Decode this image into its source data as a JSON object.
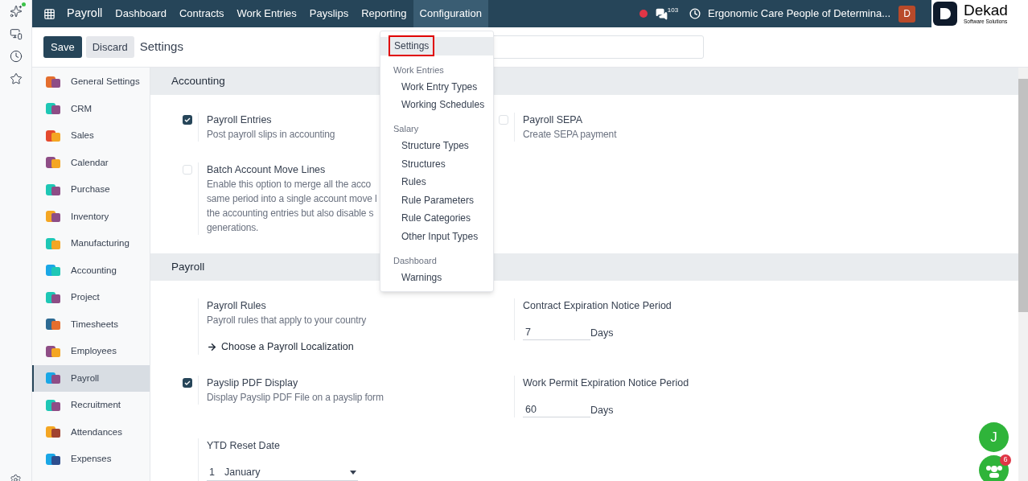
{
  "navbar": {
    "app_name": "Payroll",
    "menus": [
      {
        "label": "Dashboard",
        "selected": false
      },
      {
        "label": "Contracts",
        "selected": false
      },
      {
        "label": "Work Entries",
        "selected": false
      },
      {
        "label": "Payslips",
        "selected": false
      },
      {
        "label": "Reporting",
        "selected": false
      },
      {
        "label": "Configuration",
        "selected": true
      }
    ],
    "messages_count": "103",
    "company": "Ergonomic Care People of Determina...",
    "avatar": "D"
  },
  "logo": {
    "name": "Dekad",
    "tagline": "Software Solutions"
  },
  "control_panel": {
    "save": "Save",
    "discard": "Discard",
    "title": "Settings"
  },
  "dropdown": [
    {
      "kind": "item",
      "label": "Settings",
      "selected": true
    },
    {
      "kind": "header",
      "label": "Work Entries"
    },
    {
      "kind": "item",
      "label": "Work Entry Types",
      "selected": false
    },
    {
      "kind": "item",
      "label": "Working Schedules",
      "selected": false
    },
    {
      "kind": "header",
      "label": "Salary"
    },
    {
      "kind": "item",
      "label": "Structure Types",
      "selected": false
    },
    {
      "kind": "item",
      "label": "Structures",
      "selected": false
    },
    {
      "kind": "item",
      "label": "Rules",
      "selected": false
    },
    {
      "kind": "item",
      "label": "Rule Parameters",
      "selected": false
    },
    {
      "kind": "item",
      "label": "Rule Categories",
      "selected": false
    },
    {
      "kind": "item",
      "label": "Other Input Types",
      "selected": false
    },
    {
      "kind": "header",
      "label": "Dashboard"
    },
    {
      "kind": "item",
      "label": "Warnings",
      "selected": false
    }
  ],
  "apps": [
    {
      "label": "General Settings",
      "selected": false
    },
    {
      "label": "CRM",
      "selected": false
    },
    {
      "label": "Sales",
      "selected": false
    },
    {
      "label": "Calendar",
      "selected": false
    },
    {
      "label": "Purchase",
      "selected": false
    },
    {
      "label": "Inventory",
      "selected": false
    },
    {
      "label": "Manufacturing",
      "selected": false
    },
    {
      "label": "Accounting",
      "selected": false
    },
    {
      "label": "Project",
      "selected": false
    },
    {
      "label": "Timesheets",
      "selected": false
    },
    {
      "label": "Employees",
      "selected": false
    },
    {
      "label": "Payroll",
      "selected": true
    },
    {
      "label": "Recruitment",
      "selected": false
    },
    {
      "label": "Attendances",
      "selected": false
    },
    {
      "label": "Expenses",
      "selected": false
    }
  ],
  "sections": [
    {
      "title": "Accounting",
      "rows": [
        {
          "left": {
            "kind": "checkbox",
            "title": "Payroll Entries",
            "checked": true,
            "description": [
              "Post payroll slips in accounting"
            ]
          },
          "right": {
            "kind": "checkbox",
            "title": "Payroll SEPA",
            "checked": false,
            "description": [
              "Create SEPA payment"
            ]
          }
        },
        {
          "left": {
            "kind": "checkbox",
            "title": "Batch Account Move Lines",
            "checked": false,
            "description": [
              "Enable this option to merge all the acco",
              "same period into a single account move l",
              "the accounting entries but also disable s",
              "generations."
            ]
          }
        }
      ]
    },
    {
      "title": "Payroll",
      "rows": [
        {
          "left": {
            "kind": "info",
            "title": "Payroll Rules",
            "description": [
              "Payroll rules that apply to your country"
            ],
            "link": "Choose a Payroll Localization"
          },
          "right": {
            "kind": "number",
            "title": "Contract Expiration Notice Period",
            "value": "7",
            "unit": "Days"
          }
        },
        {
          "left": {
            "kind": "checkbox",
            "title": "Payslip PDF Display",
            "checked": true,
            "description": [
              "Display Payslip PDF File on a payslip form"
            ]
          },
          "right": {
            "kind": "number",
            "title": "Work Permit Expiration Notice Period",
            "value": "60",
            "unit": "Days"
          }
        },
        {
          "left": {
            "kind": "select",
            "title": "YTD Reset Date",
            "day": "1",
            "month": "January"
          }
        }
      ]
    }
  ],
  "chat": {
    "initial": "J",
    "badge": "6"
  }
}
